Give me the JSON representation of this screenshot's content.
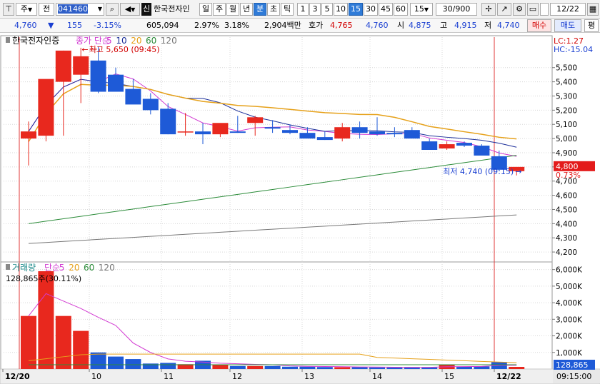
{
  "toolbar": {
    "market": "주",
    "type": "전",
    "code": "041460",
    "search_icon": "search-icon",
    "name_badge": "신",
    "stock_name": "한국전자인",
    "periods": [
      "일",
      "주",
      "월",
      "년",
      "분",
      "초",
      "틱"
    ],
    "period_selected": "분",
    "intervals": [
      "1",
      "3",
      "5",
      "10",
      "15",
      "30",
      "45",
      "60"
    ],
    "interval_selected": "15",
    "interval_input": "15",
    "count": "30/900",
    "date": "12/22"
  },
  "quote": {
    "price": "4,760",
    "change_arrow": "▼",
    "change": "155",
    "change_pct": "-3.15%",
    "volume": "605,094",
    "turnover_pct": "2.97%",
    "extra_pct": "3.18%",
    "amount": "2,904백만",
    "ask_label": "호가",
    "ask": "4,765",
    "bid": "4,760",
    "open_label": "시",
    "open": "4,875",
    "high_label": "고",
    "high": "4,915",
    "low_label": "저",
    "low": "4,740",
    "buy_button": "매수",
    "sell_button": "매도",
    "eval_button": "평"
  },
  "price_panel": {
    "title": "한국전자인증",
    "ma_label": "종가 단순",
    "ma_periods": [
      "5",
      "10",
      "20",
      "60",
      "120"
    ],
    "lc_label": "LC:1.27",
    "hc_label": "HC:-15.04",
    "max_annotation": "최고 5,650 (09:45)",
    "min_annotation": "최저 4,740 (09:15)",
    "last_price_box": "4,800",
    "last_pct_box": "0.73%",
    "y_ticks": [
      "5,500",
      "5,400",
      "5,300",
      "5,200",
      "5,100",
      "5,000",
      "4,900",
      "4,800",
      "4,700",
      "4,600",
      "4,500",
      "4,400",
      "4,300",
      "4,200"
    ]
  },
  "volume_panel": {
    "title": "거래량",
    "ma_label": "단순",
    "ma_periods": [
      "5",
      "20",
      "60",
      "120"
    ],
    "last_volume_text": "128,865주(30.11%)",
    "y_ticks": [
      "6,000K",
      "5,000K",
      "4,000K",
      "3,000K",
      "2,000K",
      "1,000K"
    ],
    "last_value_box": "128,865",
    "last_pct_box": "30.11%"
  },
  "x_axis": {
    "labels": [
      "12/20",
      "10",
      "11",
      "12",
      "13",
      "14",
      "15",
      "12/22"
    ],
    "time_label": "09:15:00"
  },
  "colors": {
    "up": "#e8281e",
    "down": "#1e5ad7",
    "ma5": "#d23bd2",
    "ma10": "#1c2f9a",
    "ma20": "#e6a11a",
    "ma60": "#2c8c3a",
    "ma120": "#777777"
  },
  "chart_data": {
    "type": "candlestick",
    "x": [
      "12/20 09:00",
      "09:15",
      "09:30",
      "09:45",
      "10:00",
      "10:15",
      "10:30",
      "10:45",
      "11:00",
      "11:15",
      "11:30",
      "11:45",
      "12:00",
      "12:15",
      "12:30",
      "12:45",
      "13:00",
      "13:15",
      "13:30",
      "13:45",
      "14:00",
      "14:15",
      "14:30",
      "14:45",
      "15:00",
      "15:15",
      "15:30",
      "12/22 09:00",
      "09:15"
    ],
    "open": [
      5000,
      5020,
      5400,
      5450,
      5550,
      5450,
      5350,
      5280,
      5210,
      5050,
      5050,
      5030,
      5050,
      5110,
      5080,
      5060,
      5040,
      5010,
      5000,
      5080,
      5050,
      5040,
      5060,
      4980,
      4930,
      4970,
      4950,
      4875,
      4770
    ],
    "high": [
      5120,
      5300,
      5620,
      5640,
      5650,
      5500,
      5420,
      5320,
      5250,
      5180,
      5110,
      5100,
      5160,
      5160,
      5130,
      5100,
      5080,
      5050,
      5110,
      5120,
      5150,
      5080,
      5080,
      5000,
      4980,
      4980,
      4960,
      4915,
      4790
    ],
    "low": [
      4810,
      4980,
      5020,
      5250,
      5320,
      5340,
      5260,
      5170,
      5030,
      5020,
      4960,
      5010,
      5040,
      5020,
      5040,
      5030,
      5010,
      4990,
      4980,
      5000,
      5020,
      5010,
      5020,
      4930,
      4920,
      4940,
      4930,
      4770,
      4740
    ],
    "close": [
      5050,
      5420,
      5620,
      5580,
      5330,
      5330,
      5240,
      5200,
      5030,
      5050,
      5030,
      5110,
      5040,
      5150,
      5070,
      5040,
      5000,
      4990,
      5080,
      5040,
      5030,
      5030,
      5000,
      4920,
      4960,
      4950,
      4880,
      4780,
      4800
    ],
    "volume_k": [
      3200,
      5900,
      3200,
      2300,
      1000,
      750,
      600,
      330,
      370,
      290,
      500,
      260,
      180,
      180,
      180,
      140,
      140,
      120,
      110,
      110,
      100,
      100,
      100,
      100,
      280,
      150,
      160,
      420,
      129
    ],
    "volume_ylim_k": [
      0,
      6200
    ],
    "price_ylim": [
      4140,
      5700
    ]
  }
}
